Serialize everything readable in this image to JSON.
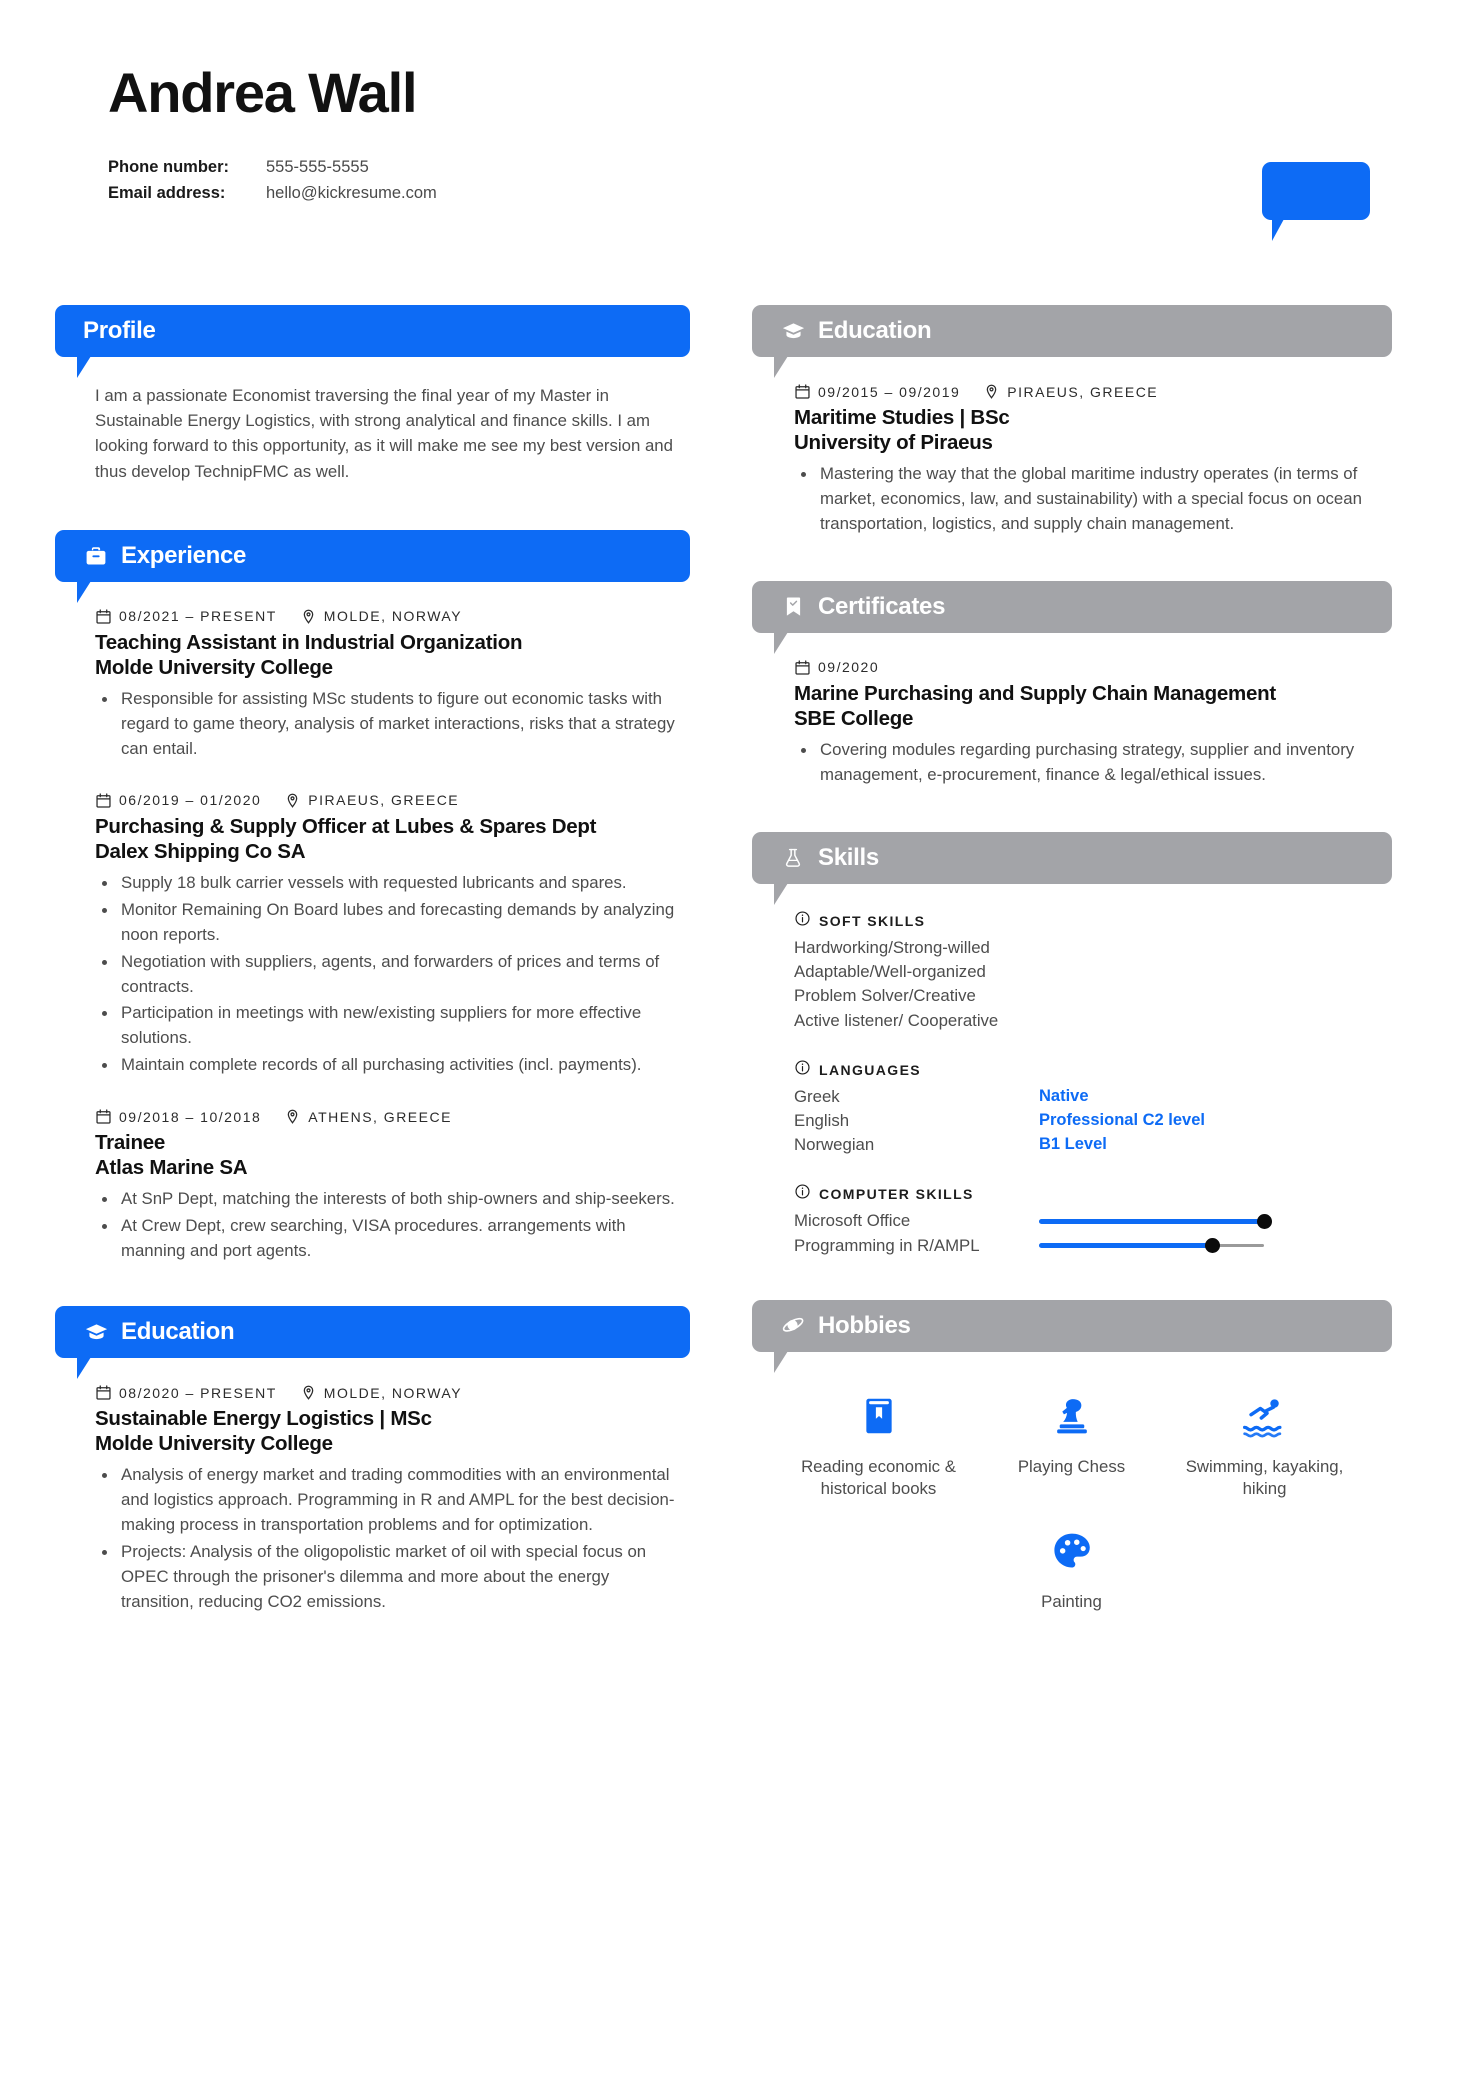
{
  "header": {
    "name": "Andrea Wall",
    "phone_label": "Phone number:",
    "phone_value": "555-555-5555",
    "email_label": "Email address:",
    "email_value": "hello@kickresume.com"
  },
  "colors": {
    "accent_blue": "#0d6bf5",
    "header_gray": "#a3a4a8",
    "body_text": "#4d4d4d"
  },
  "sections": {
    "profile": {
      "title": "Profile",
      "icon": "none",
      "text": "I am a passionate Economist traversing the final year of my Master in Sustainable Energy Logistics, with strong analytical and finance skills. I am looking forward to this opportunity, as it will make me see my best version and thus develop TechnipFMC as well."
    },
    "experience": {
      "title": "Experience",
      "icon": "briefcase-icon",
      "entries": [
        {
          "date": "08/2021 – PRESENT",
          "location": "MOLDE, NORWAY",
          "title": "Teaching Assistant in Industrial Organization",
          "org": "Molde University College",
          "bullets": [
            "Responsible for assisting MSc students to figure out economic tasks with regard to game theory, analysis of market interactions, risks that a strategy can entail."
          ]
        },
        {
          "date": "06/2019 – 01/2020",
          "location": "PIRAEUS, GREECE",
          "title": "Purchasing & Supply Officer at Lubes & Spares Dept",
          "org": "Dalex Shipping Co SA",
          "bullets": [
            "Supply 18 bulk carrier vessels with requested lubricants and spares.",
            "Monitor Remaining On Board lubes and forecasting demands by analyzing noon reports.",
            "Negotiation with suppliers, agents, and forwarders of prices and terms of contracts.",
            "Participation in meetings with new/existing suppliers for more effective solutions.",
            "Maintain complete records of all purchasing activities (incl. payments)."
          ]
        },
        {
          "date": "09/2018 – 10/2018",
          "location": "ATHENS, GREECE",
          "title": "Trainee",
          "org": "Atlas Marine SA",
          "bullets": [
            "At SnP Dept, matching the interests of both ship-owners and ship-seekers.",
            "At Crew Dept, crew searching, VISA procedures. arrangements with manning and port agents."
          ]
        }
      ]
    },
    "education_left": {
      "title": "Education",
      "icon": "graduation-cap-icon",
      "entries": [
        {
          "date": "08/2020 – PRESENT",
          "location": "MOLDE, NORWAY",
          "title": "Sustainable Energy Logistics | MSc",
          "org": "Molde University College",
          "bullets": [
            "Analysis of energy market and trading commodities with an environmental and logistics approach. Programming in R and AMPL for the best decision-making process in transportation problems and for optimization.",
            "Projects: Analysis of the oligopolistic market of oil with special focus on OPEC through the prisoner's dilemma and more about the energy transition, reducing CO2 emissions."
          ]
        }
      ]
    },
    "education_right": {
      "title": "Education",
      "icon": "graduation-cap-icon",
      "entries": [
        {
          "date": "09/2015 – 09/2019",
          "location": "PIRAEUS, GREECE",
          "title": "Maritime Studies | BSc",
          "org": "University of Piraeus",
          "bullets": [
            "Mastering the way that the global maritime industry operates (in terms of market, economics, law, and sustainability) with a special focus on ocean transportation, logistics, and supply chain management."
          ]
        }
      ]
    },
    "certificates": {
      "title": "Certificates",
      "icon": "bookmark-check-icon",
      "entries": [
        {
          "date": "09/2020",
          "location": "",
          "title": "Marine Purchasing and Supply Chain Management",
          "org": "SBE College",
          "bullets": [
            "Covering modules regarding purchasing strategy, supplier and inventory management, e-procurement, finance & legal/ethical issues."
          ]
        }
      ]
    },
    "skills": {
      "title": "Skills",
      "icon": "flask-icon",
      "groups": [
        {
          "label": "SOFT SKILLS",
          "type": "list",
          "items": [
            {
              "name": "Hardworking/Strong-willed"
            },
            {
              "name": "Adaptable/Well-organized"
            },
            {
              "name": "Problem Solver/Creative"
            },
            {
              "name": "Active listener/ Cooperative"
            }
          ]
        },
        {
          "label": "LANGUAGES",
          "type": "level",
          "items": [
            {
              "name": "Greek",
              "level": "Native"
            },
            {
              "name": "English",
              "level": "Professional C2 level"
            },
            {
              "name": "Norwegian",
              "level": "B1 Level"
            }
          ]
        },
        {
          "label": "COMPUTER SKILLS",
          "type": "slider",
          "items": [
            {
              "name": "Microsoft Office",
              "value": 100
            },
            {
              "name": "Programming in R/AMPL",
              "value": 77
            }
          ]
        }
      ]
    },
    "hobbies": {
      "title": "Hobbies",
      "icon": "planet-icon",
      "items": [
        {
          "icon": "book-icon",
          "label": "Reading economic & historical books"
        },
        {
          "icon": "chess-icon",
          "label": "Playing Chess"
        },
        {
          "icon": "swimming-icon",
          "label": "Swimming, kayaking, hiking"
        },
        {
          "icon": "palette-icon",
          "label": "Painting"
        }
      ]
    }
  }
}
